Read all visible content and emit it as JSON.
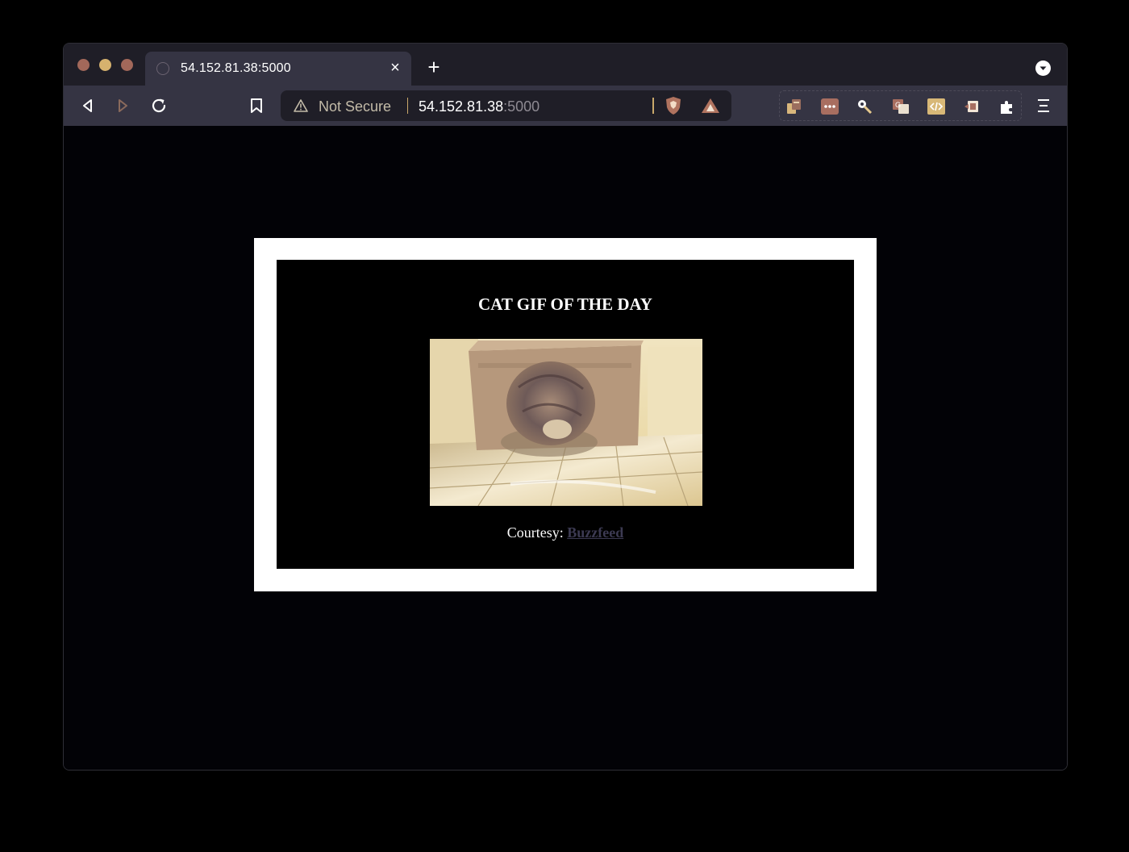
{
  "browser": {
    "tab": {
      "title": "54.152.81.38:5000",
      "close_label": "×"
    },
    "new_tab_label": "+",
    "address_bar": {
      "security_label": "Not Secure",
      "host": "54.152.81.38",
      "port": ":5000"
    },
    "toolbar_icons": [
      "back-icon",
      "forward-icon",
      "reload-icon",
      "bookmark-icon",
      "brave-shields-icon",
      "brave-rewards-icon",
      "extension-icons",
      "puzzle-icon",
      "menu-icon"
    ],
    "colors": {
      "tabstrip": "#1f1e27",
      "toolbar": "#353443",
      "warning": "#c9a86a"
    }
  },
  "page": {
    "heading": "CAT GIF OF THE DAY",
    "courtesy_prefix": "Courtesy:",
    "courtesy_link": "Buzzfeed"
  }
}
